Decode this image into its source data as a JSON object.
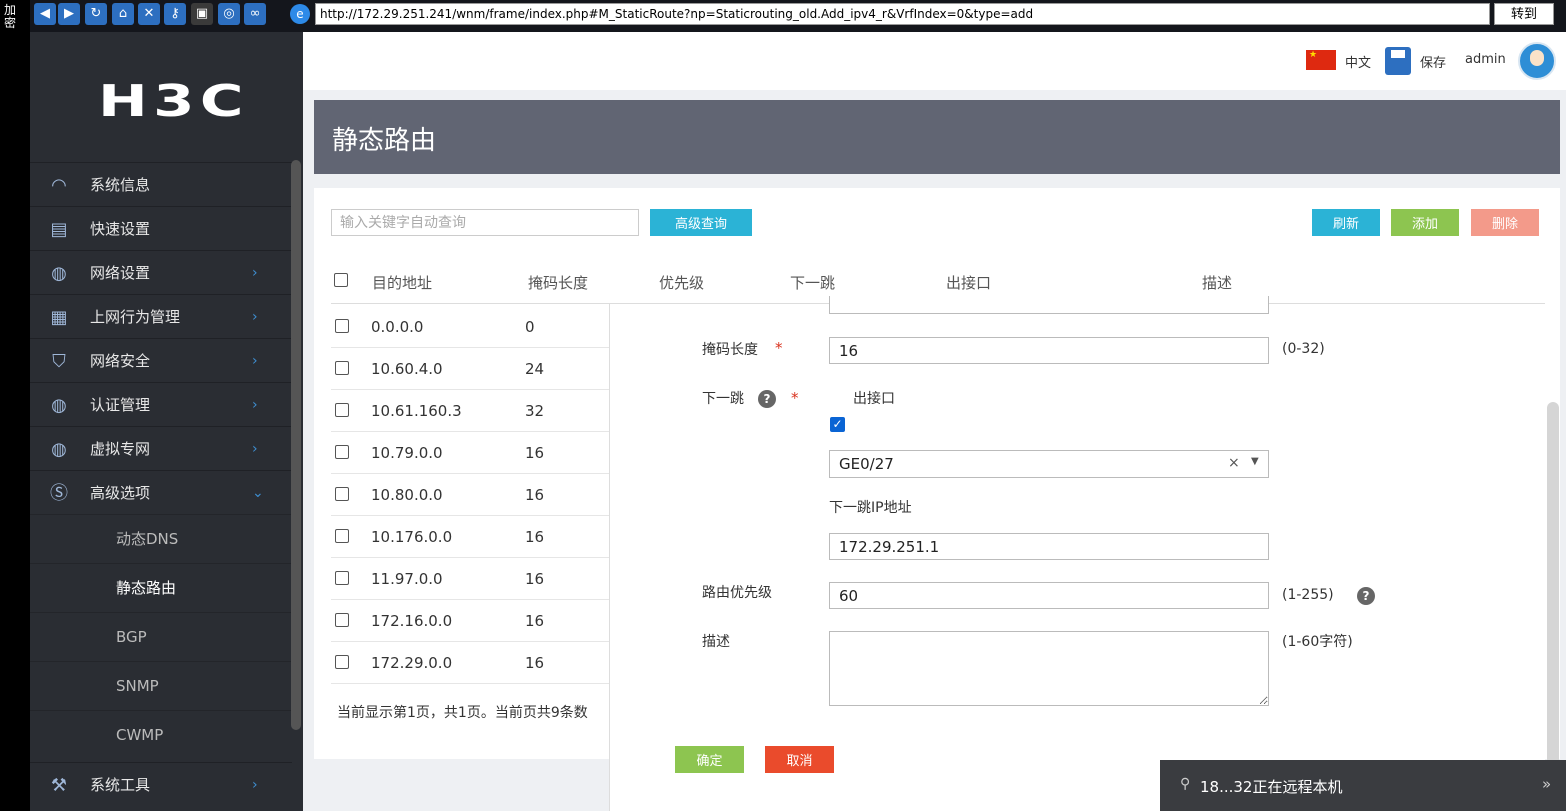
{
  "edge_strip": {
    "text": "加密"
  },
  "browser": {
    "url": "http://172.29.251.241/wnm/frame/index.php#M_StaticRoute?np=Staticrouting_old.Add_ipv4_r&VrfIndex=0&type=add",
    "go_label": "转到",
    "icons": [
      "back-icon",
      "forward-icon",
      "refresh-icon",
      "home-icon",
      "stop-icon",
      "key-icon",
      "console-icon",
      "globe-icon",
      "binoculars-icon"
    ]
  },
  "sidebar": {
    "logo": "H3C",
    "items": [
      {
        "label": "系统信息",
        "icon": "gauge-icon",
        "has_children": false
      },
      {
        "label": "快速设置",
        "icon": "clipboard-icon",
        "has_children": false
      },
      {
        "label": "网络设置",
        "icon": "globe-icon",
        "has_children": true
      },
      {
        "label": "上网行为管理",
        "icon": "grid-icon",
        "has_children": true
      },
      {
        "label": "网络安全",
        "icon": "shield-icon",
        "has_children": true
      },
      {
        "label": "认证管理",
        "icon": "globe-icon",
        "has_children": true
      },
      {
        "label": "虚拟专网",
        "icon": "globe-lock-icon",
        "has_children": true
      },
      {
        "label": "高级选项",
        "icon": "s-logo-icon",
        "has_children": true,
        "expanded": true
      }
    ],
    "sub_items": [
      {
        "label": "动态DNS"
      },
      {
        "label": "静态路由",
        "active": true
      },
      {
        "label": "BGP"
      },
      {
        "label": "SNMP"
      },
      {
        "label": "CWMP"
      }
    ],
    "last_item": {
      "label": "系统工具",
      "icon": "tools-icon"
    }
  },
  "header": {
    "lang": "中文",
    "save": "保存",
    "user": "admin"
  },
  "page": {
    "title": "静态路由",
    "search_placeholder": "输入关键字自动查询",
    "adv_search": "高级查询",
    "refresh": "刷新",
    "add": "添加",
    "delete": "删除",
    "columns": [
      "目的地址",
      "掩码长度",
      "优先级",
      "下一跳",
      "出接口",
      "描述"
    ],
    "rows": [
      {
        "dest": "0.0.0.0",
        "mask": "0"
      },
      {
        "dest": "10.60.4.0",
        "mask": "24"
      },
      {
        "dest": "10.61.160.3",
        "mask": "32"
      },
      {
        "dest": "10.79.0.0",
        "mask": "16"
      },
      {
        "dest": "10.80.0.0",
        "mask": "16"
      },
      {
        "dest": "10.176.0.0",
        "mask": "16"
      },
      {
        "dest": "11.97.0.0",
        "mask": "16"
      },
      {
        "dest": "172.16.0.0",
        "mask": "16"
      },
      {
        "dest": "172.29.0.0",
        "mask": "16"
      }
    ],
    "footer": "当前显示第1页，共1页。当前页共9条数"
  },
  "form": {
    "mask_label": "掩码长度",
    "mask_value": "16",
    "mask_hint": "(0-32)",
    "nexthop_label": "下一跳",
    "outif_checkbox_label": "出接口",
    "outif_value": "GE0/27",
    "nexthop_ip_label": "下一跳IP地址",
    "nexthop_ip_value": "172.29.251.1",
    "priority_label": "路由优先级",
    "priority_value": "60",
    "priority_hint": "(1-255)",
    "desc_label": "描述",
    "desc_hint": "(1-60字符)",
    "ok": "确定",
    "cancel": "取消",
    "required_mark": "*",
    "help_mark": "?"
  },
  "remote": {
    "text": "18...32正在远程本机",
    "more": "»"
  }
}
